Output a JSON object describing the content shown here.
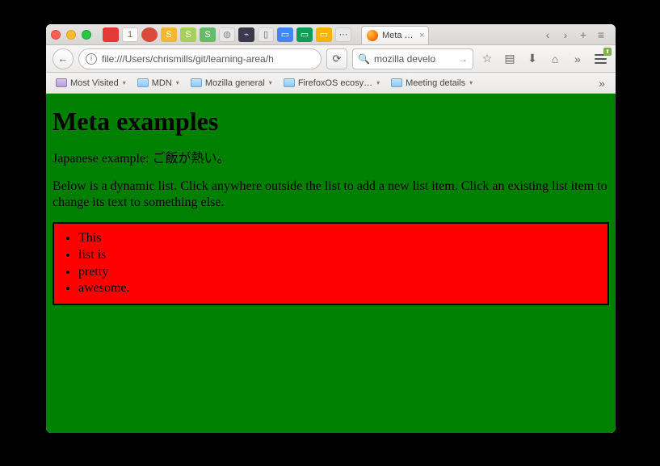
{
  "tab": {
    "title": "Meta …",
    "close": "×"
  },
  "tabcontrols": {
    "back": "‹",
    "fwd": "›",
    "plus": "+",
    "menu": "≡"
  },
  "url": {
    "value": "file:///Users/chrismills/git/learning-area/h",
    "reload": "⟳"
  },
  "search": {
    "value": "mozilla develo",
    "go": "→"
  },
  "actions": {
    "star": "☆",
    "reader": "▤",
    "download": "⬇",
    "home": "⌂",
    "overflow": "»"
  },
  "bookmarks": {
    "most_visited": "Most Visited",
    "mdn": "MDN",
    "mozilla_general": "Mozilla general",
    "firefoxos": "FirefoxOS ecosy…",
    "meeting": "Meeting details",
    "overflow": "»"
  },
  "page": {
    "h1": "Meta examples",
    "p1": "Japanese example: ご飯が熱い。",
    "p2": "Below is a dynamic list. Click anywhere outside the list to add a new list item. Click an existing list item to change its text to something else.",
    "list": [
      "This",
      "list is",
      "pretty",
      "awesome."
    ]
  },
  "ext": {
    "s": "S"
  }
}
